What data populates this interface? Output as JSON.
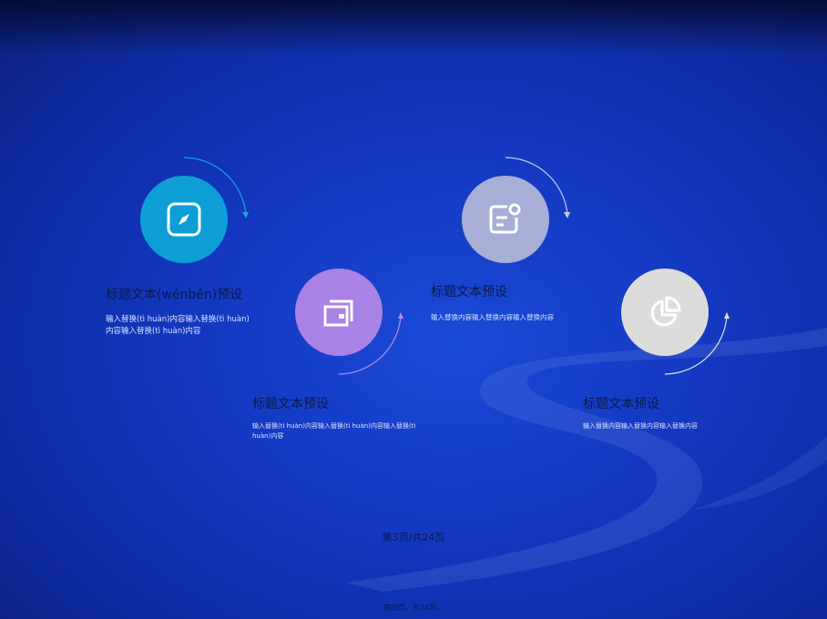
{
  "items": [
    {
      "title": "标题文本(wénběn)预设",
      "desc": "输入替换(tì huàn)内容输入替换(tì huàn)内容输入替换(tì huàn)内容",
      "icon": "compass-icon",
      "color": "#0e9ed6"
    },
    {
      "title": "标题文本预设",
      "desc": "输入替换(tì huàn)内容输入替换(tì huàn)内容输入替换(tì huàn)内容",
      "icon": "wallet-icon",
      "color": "#a882e4"
    },
    {
      "title": "标题文本预设",
      "desc": "输入替换内容输入替换内容输入替换内容",
      "icon": "note-icon",
      "color": "#a7afd6"
    },
    {
      "title": "标题文本预设",
      "desc": "输入替换内容输入替换内容输入替换内容",
      "icon": "pie-chart-icon",
      "color": "#dcdcdc"
    }
  ],
  "footer": {
    "page_indicator": "第3页/共24页",
    "page_sub": "第四页，共24页。"
  }
}
